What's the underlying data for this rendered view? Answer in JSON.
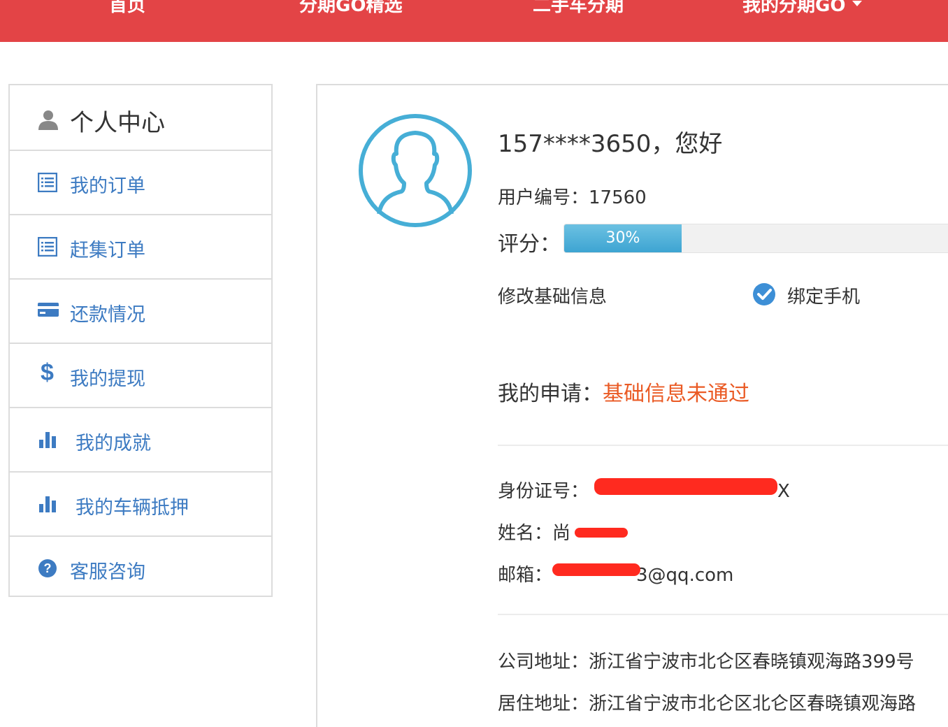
{
  "nav": {
    "items": [
      "首页",
      "分期GO精选",
      "二手车分期",
      "我的分期GO"
    ],
    "color": "#e34446"
  },
  "sidebar": {
    "title": "个人中心",
    "items": [
      {
        "label": "我的订单",
        "icon": "list-icon"
      },
      {
        "label": "赶集订单",
        "icon": "list-icon"
      },
      {
        "label": "还款情况",
        "icon": "credit-card-icon"
      },
      {
        "label": "我的提现",
        "icon": "dollar-icon"
      },
      {
        "label": "我的成就",
        "icon": "bar-chart-icon"
      },
      {
        "label": "我的车辆抵押",
        "icon": "bar-chart-icon"
      },
      {
        "label": "客服咨询",
        "icon": "question-icon"
      }
    ],
    "accent": "#3d7bc2"
  },
  "profile": {
    "greeting": "157****3650，您好",
    "user_id_label": "用户编号：",
    "user_id": "17560",
    "score_label": "评分：",
    "score_text": "30%",
    "score_value": 0.3,
    "edit_info": "修改基础信息",
    "bind_phone": "绑定手机",
    "application_label": "我的申请：",
    "application_status": "基础信息未通过",
    "status_color": "#ea5a24"
  },
  "details": {
    "id_label": "身份证号：",
    "id_visible": "X",
    "name_label": "姓名：",
    "name_visible": "尚",
    "email_label": "邮箱：",
    "email_visible": "3@qq.com",
    "company_label": "公司地址：",
    "company_value": "浙江省宁波市北仑区春晓镇观海路399号",
    "home_label": "居住地址：",
    "home_value": "浙江省宁波市北仑区北仑区春晓镇观海路"
  }
}
